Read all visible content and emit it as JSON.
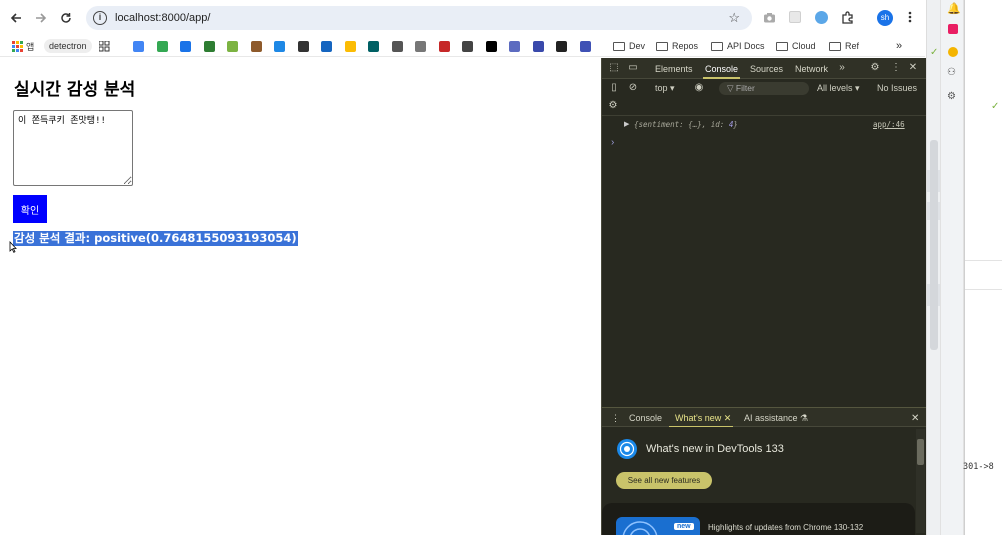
{
  "browser": {
    "url": "localhost:8000/app/",
    "profile_initials": "sh",
    "nav_icons": [
      "back-arrow-icon",
      "forward-arrow-icon",
      "reload-icon"
    ],
    "omnibox_icons": [
      "site-info-icon",
      "bookmark-star-icon"
    ],
    "toolbar_icons": [
      "camera-icon",
      "extension-blank-icon",
      "extension-feather-icon",
      "extensions-puzzle-icon",
      "menu-kebab-icon"
    ]
  },
  "bookmarks": {
    "apps_label": "앱",
    "detectron_label": "detectron",
    "folders": [
      "Dev",
      "Repos",
      "API Docs",
      "Cloud",
      "Ref"
    ],
    "more_icon": "chevron-double-right-icon",
    "favicon_colors": [
      "#4285f4",
      "#34a853",
      "#1a73e8",
      "#2e7d32",
      "#7cb342",
      "#8e5a2b",
      "#1e88e5",
      "#333333",
      "#1565c0",
      "#fbbc04",
      "#006064",
      "#555555",
      "#777777",
      "#c62828",
      "#444444",
      "#000000",
      "#5c6bc0",
      "#3949ab",
      "#222222",
      "#3f51b5"
    ]
  },
  "page": {
    "heading": "실시간 감성 분석",
    "textarea_value": "이 쫀득쿠키 존맛탱!!",
    "confirm_label": "확인",
    "confirm_color": "#0000ff",
    "result_text": "감성 분석 결과: positive(0.7648155093193054)",
    "selection_color": "#3a72d8"
  },
  "devtools": {
    "tabs": [
      "Elements",
      "Console",
      "Sources",
      "Network"
    ],
    "active_tab": "Console",
    "context": "top",
    "filter_placeholder": "Filter",
    "levels": "All levels",
    "issues": "No Issues",
    "log_entry": {
      "prefix": "{sentiment: {…}, id: ",
      "id_value": "4",
      "suffix": "}",
      "source": "app/:46"
    },
    "drawer_tabs": [
      "Console",
      "What's new",
      "AI assistance"
    ],
    "active_drawer_tab": "What's new",
    "whats_new_title": "What's new in DevTools 133",
    "see_all_label": "See all new features",
    "card_badge": "new",
    "card_text": "Highlights of updates from Chrome 130-132",
    "accent_color": "#c9c36a",
    "background_color": "#282920"
  },
  "background_window": {
    "code_snippet": "301->8"
  }
}
